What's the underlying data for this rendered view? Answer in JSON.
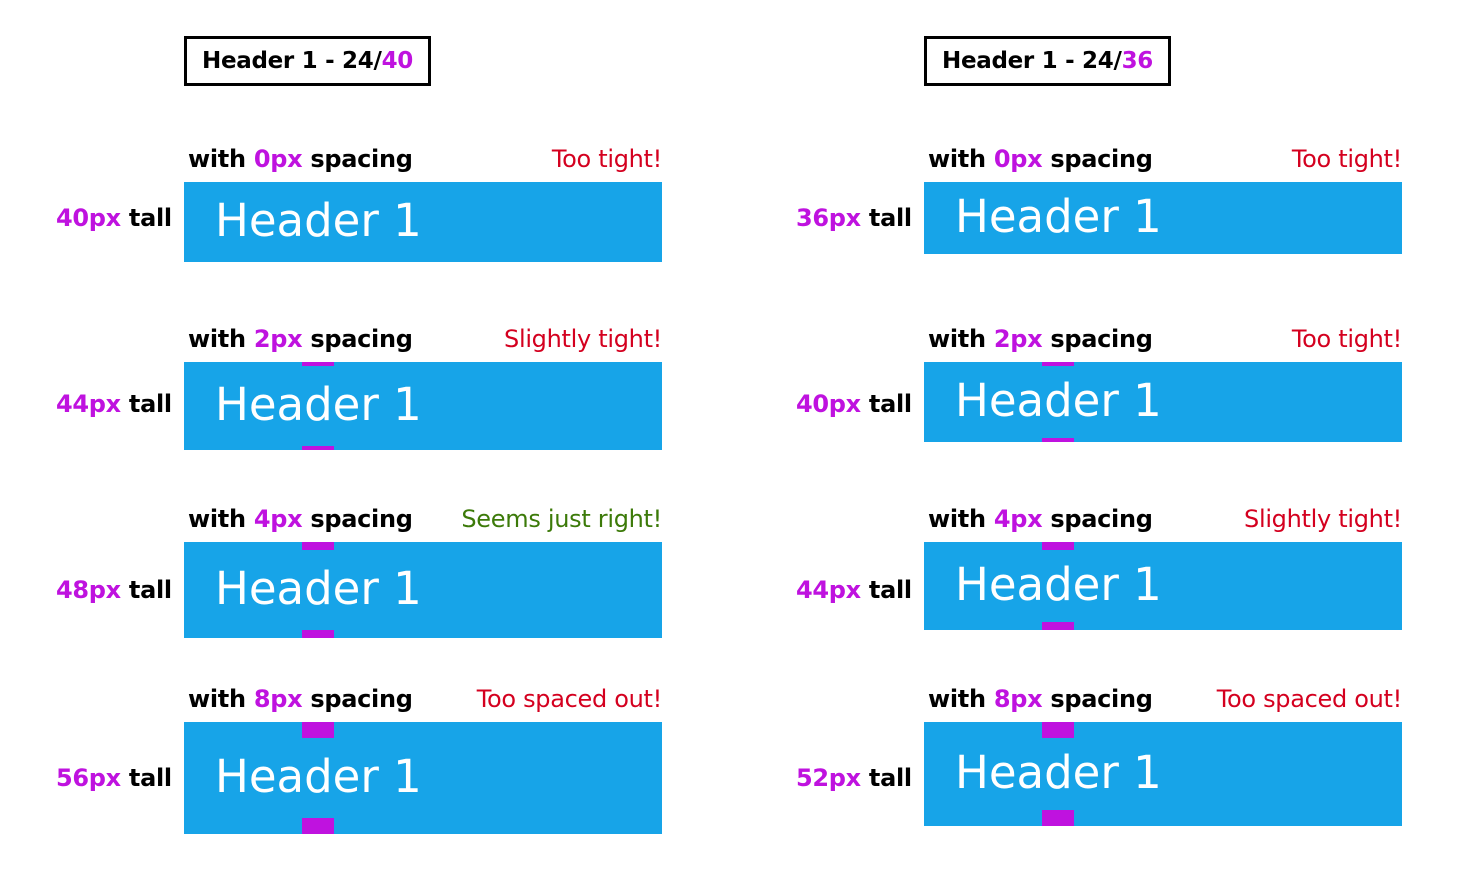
{
  "columns": [
    {
      "title_prefix": "Header 1 - 24/",
      "title_accent": "40",
      "rows": [
        {
          "caption_prefix": "with ",
          "spacing": "0px",
          "caption_suffix": " spacing",
          "verdict": "Too tight!",
          "verdict_type": "bad",
          "height_value": "40px",
          "height_suffix": " tall",
          "bar_text": "Header 1"
        },
        {
          "caption_prefix": "with ",
          "spacing": "2px",
          "caption_suffix": " spacing",
          "verdict": "Slightly tight!",
          "verdict_type": "bad",
          "height_value": "44px",
          "height_suffix": " tall",
          "bar_text": "Header 1"
        },
        {
          "caption_prefix": "with ",
          "spacing": "4px",
          "caption_suffix": " spacing",
          "verdict": "Seems just right!",
          "verdict_type": "good",
          "height_value": "48px",
          "height_suffix": " tall",
          "bar_text": "Header 1"
        },
        {
          "caption_prefix": "with ",
          "spacing": "8px",
          "caption_suffix": " spacing",
          "verdict": "Too spaced out!",
          "verdict_type": "bad",
          "height_value": "56px",
          "height_suffix": " tall",
          "bar_text": "Header 1"
        }
      ]
    },
    {
      "title_prefix": "Header 1 - 24/",
      "title_accent": "36",
      "rows": [
        {
          "caption_prefix": "with ",
          "spacing": "0px",
          "caption_suffix": " spacing",
          "verdict": "Too tight!",
          "verdict_type": "bad",
          "height_value": "36px",
          "height_suffix": " tall",
          "bar_text": "Header 1"
        },
        {
          "caption_prefix": "with ",
          "spacing": "2px",
          "caption_suffix": " spacing",
          "verdict": "Too tight!",
          "verdict_type": "bad",
          "height_value": "40px",
          "height_suffix": " tall",
          "bar_text": "Header 1"
        },
        {
          "caption_prefix": "with ",
          "spacing": "4px",
          "caption_suffix": " spacing",
          "verdict": "Slightly tight!",
          "verdict_type": "bad",
          "height_value": "44px",
          "height_suffix": " tall",
          "bar_text": "Header 1"
        },
        {
          "caption_prefix": "with ",
          "spacing": "8px",
          "caption_suffix": " spacing",
          "verdict": "Too spaced out!",
          "verdict_type": "bad",
          "height_value": "52px",
          "height_suffix": " tall",
          "bar_text": "Header 1"
        }
      ]
    }
  ],
  "colors": {
    "bar": "#17a4e8",
    "accent": "#bf12df",
    "bad": "#d4001f",
    "good": "#3c7a09"
  }
}
